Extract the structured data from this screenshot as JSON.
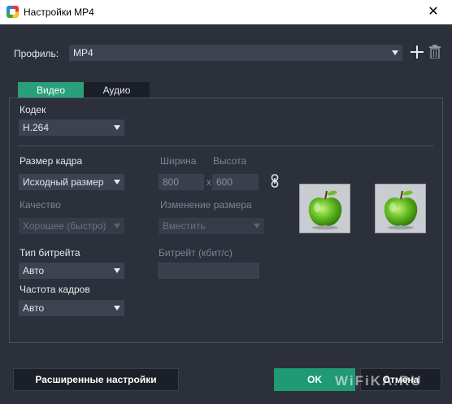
{
  "window": {
    "title": "Настройки MP4",
    "close_glyph": "✕"
  },
  "profile": {
    "label": "Профиль:",
    "value": "MP4"
  },
  "tabs": [
    {
      "label": "Видео",
      "active": true
    },
    {
      "label": "Аудио",
      "active": false
    }
  ],
  "video": {
    "codec": {
      "label": "Кодек",
      "value": "H.264"
    },
    "frame_size": {
      "label": "Размер кадра",
      "value": "Исходный размер"
    },
    "width": {
      "label": "Ширина",
      "value": "800"
    },
    "height": {
      "label": "Высота",
      "value": "600"
    },
    "size_separator": "x",
    "quality": {
      "label": "Качество",
      "value": "Хорошее (быстро)"
    },
    "resize": {
      "label": "Изменение размера",
      "value": "Вместить"
    },
    "bitrate_type": {
      "label": "Тип битрейта",
      "value": "Авто"
    },
    "bitrate": {
      "label": "Битрейт (кбит/с)",
      "value": ""
    },
    "frame_rate": {
      "label": "Частота кадров",
      "value": "Авто"
    }
  },
  "buttons": {
    "advanced": "Расширенные настройки",
    "ok": "OK",
    "cancel": "Отмена"
  },
  "watermark": {
    "text_a": "WiFiKA",
    "dot": ".",
    "text_b": "RU"
  },
  "icons": {
    "add": "plus-icon",
    "delete": "trash-icon",
    "link": "link-icon",
    "preview": "apple-icon"
  },
  "colors": {
    "accent": "#2aa07a",
    "background": "#2b303b",
    "field": "#3c4250"
  }
}
